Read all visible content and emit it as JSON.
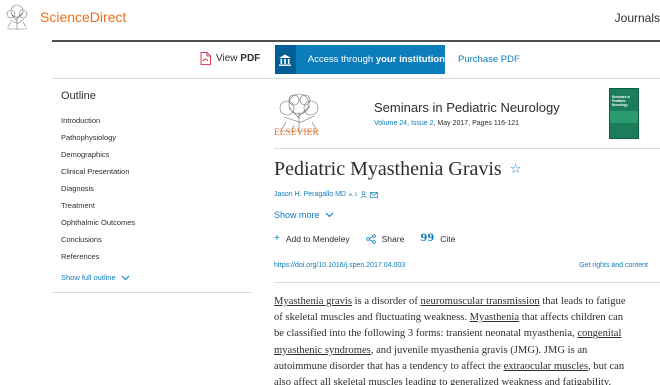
{
  "header": {
    "brand": "ScienceDirect",
    "journals_link": "Journals"
  },
  "access_bar": {
    "view_pdf_prefix": "View",
    "view_pdf_bold": "PDF",
    "access_prefix": "Access through",
    "access_bold": "your institution",
    "purchase_pdf": "Purchase PDF"
  },
  "outline": {
    "title": "Outline",
    "items": [
      "Introduction",
      "Pathophysiology",
      "Demographics",
      "Clinical Presentation",
      "Diagnosis",
      "Treatment",
      "Ophthalmic Outcomes",
      "Conclusions",
      "References"
    ],
    "show_full": "Show full outline"
  },
  "journal": {
    "publisher_word": "ELSEVIER",
    "title": "Seminars in Pediatric Neurology",
    "volume_issue": "Volume 24, Issue 2",
    "date_pages": ", May 2017, Pages 116-121",
    "cover_label": "Seminars in Pediatric Neurology"
  },
  "article": {
    "title": "Pediatric Myasthenia Gravis",
    "author": "Jason H. Peragallo MD",
    "author_sup": "a, 1",
    "show_more": "Show more",
    "actions": {
      "add_mendeley": "Add to Mendeley",
      "share": "Share",
      "cite": "Cite"
    },
    "doi": "https://doi.org/10.1016/j.spen.2017.04.003",
    "rights": "Get rights and content",
    "abstract_lines": [
      [
        {
          "t": "Myasthenia gravis",
          "u": true
        },
        {
          "t": " is a disorder of ",
          "u": false
        },
        {
          "t": "neuromuscular transmission",
          "u": true
        },
        {
          "t": " that leads to fatigue",
          "u": false
        }
      ],
      [
        {
          "t": "of skeletal muscles and fluctuating weakness. ",
          "u": false
        },
        {
          "t": "Myasthenia",
          "u": true
        },
        {
          "t": " that affects children can",
          "u": false
        }
      ],
      [
        {
          "t": "be classified into the following 3 forms: transient neonatal myasthenia, ",
          "u": false
        },
        {
          "t": "congenital",
          "u": true
        }
      ],
      [
        {
          "t": "myasthenic syndromes",
          "u": true
        },
        {
          "t": ", and juvenile myasthenia gravis (JMG). JMG is an",
          "u": false
        }
      ],
      [
        {
          "t": "autoimmune disorder that has a tendency to affect the ",
          "u": false
        },
        {
          "t": "extraocular muscles",
          "u": true
        },
        {
          "t": ", but can",
          "u": false
        }
      ],
      [
        {
          "t": "also affect all skeletal muscles leading to generalized weakness and fatigability.",
          "u": false
        }
      ]
    ]
  },
  "colors": {
    "brand_orange": "#e9711c",
    "link_blue": "#0c7dbb",
    "text": "#2e2e2e"
  }
}
